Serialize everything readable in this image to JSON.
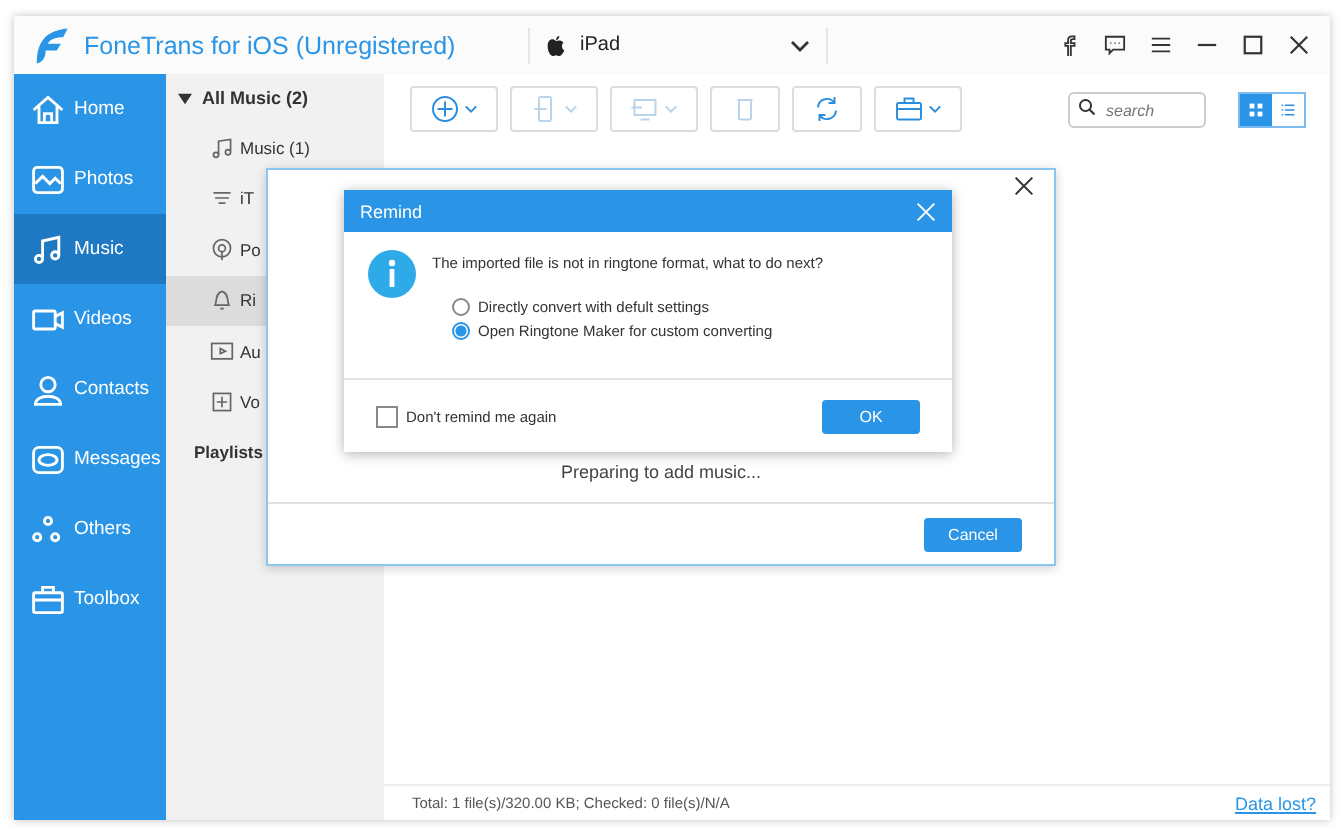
{
  "app": {
    "title": "FoneTrans for iOS (Unregistered)"
  },
  "device": {
    "name": "iPad"
  },
  "sidebar": {
    "items": [
      {
        "label": "Home",
        "kind": "home",
        "selected": false
      },
      {
        "label": "Photos",
        "kind": "photo",
        "selected": false
      },
      {
        "label": "Music",
        "kind": "music",
        "selected": true
      },
      {
        "label": "Videos",
        "kind": "video",
        "selected": false
      },
      {
        "label": "Contacts",
        "kind": "contact",
        "selected": false
      },
      {
        "label": "Messages",
        "kind": "message",
        "selected": false
      },
      {
        "label": "Others",
        "kind": "others",
        "selected": false
      },
      {
        "label": "Toolbox",
        "kind": "toolbox",
        "selected": false
      }
    ]
  },
  "music_panel": {
    "header": {
      "label": "All Music (2)",
      "expanded": true
    },
    "items": [
      {
        "label": "Music (1)",
        "kind": "note",
        "selected": false
      },
      {
        "label": "iT",
        "kind": "itunes",
        "selected": false
      },
      {
        "label": "Po",
        "kind": "podcast",
        "selected": false
      },
      {
        "label": "Ri",
        "kind": "bell",
        "selected": true
      },
      {
        "label": "Au",
        "kind": "book",
        "selected": false
      },
      {
        "label": "Vo",
        "kind": "voice",
        "selected": false
      }
    ],
    "playlists": "Playlists"
  },
  "toolbar": {
    "buttons": [
      {
        "kind": "add",
        "dropdown": true,
        "disabled": false
      },
      {
        "kind": "phone",
        "dropdown": true,
        "disabled": true
      },
      {
        "kind": "pc",
        "dropdown": true,
        "disabled": true
      },
      {
        "kind": "trash",
        "dropdown": false,
        "disabled": true
      },
      {
        "kind": "refresh",
        "dropdown": false,
        "disabled": false
      },
      {
        "kind": "toolbox",
        "dropdown": true,
        "disabled": false
      }
    ]
  },
  "search": {
    "placeholder": "search"
  },
  "view_toggle": [
    {
      "kind": "grid",
      "selected": true
    },
    {
      "kind": "list",
      "selected": false
    }
  ],
  "progress_dialog": {
    "message": "Preparing to add music...",
    "cancel": "Cancel"
  },
  "remind_dialog": {
    "title": "Remind",
    "message": "The imported file is not in ringtone format, what to do next?",
    "options": [
      {
        "label": "Directly convert with defult settings",
        "selected": false
      },
      {
        "label": "Open Ringtone Maker for custom converting",
        "selected": true
      }
    ],
    "dont_remind": {
      "label": "Don't remind me again",
      "checked": false
    },
    "ok": "OK"
  },
  "status_bar": {
    "summary": "Total: 1 file(s)/320.00 KB; Checked: 0 file(s)/N/A",
    "link": "Data lost?"
  }
}
